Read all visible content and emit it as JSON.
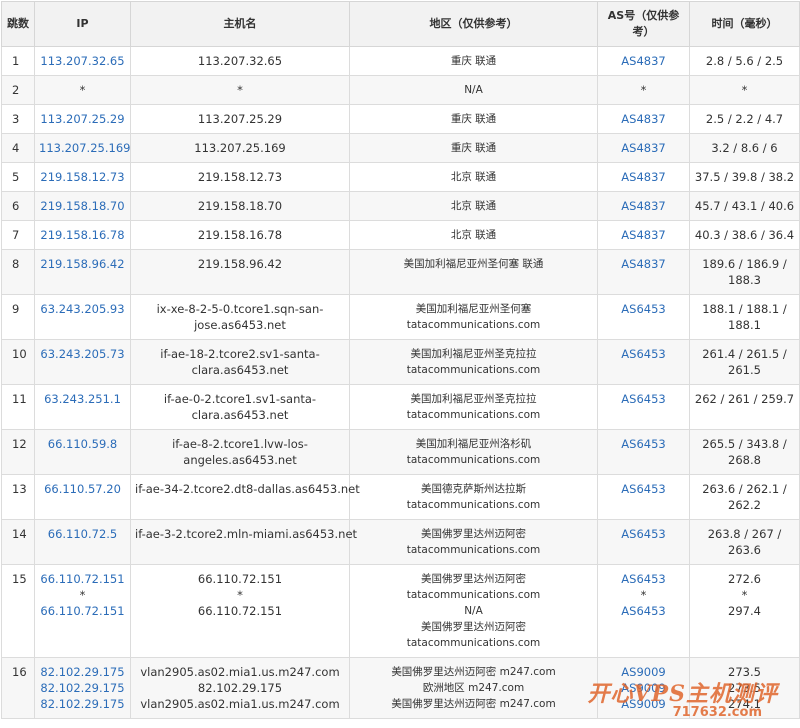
{
  "headers": {
    "hop": "跳数",
    "ip": "IP",
    "host": "主机名",
    "region": "地区（仅供参考）",
    "as": "AS号（仅供参考）",
    "time": "时间（毫秒）"
  },
  "rows": [
    {
      "hop": "1",
      "ips": [
        "113.207.32.65"
      ],
      "hosts": [
        "113.207.32.65"
      ],
      "regions": [
        "重庆 联通"
      ],
      "as": [
        "AS4837"
      ],
      "times": [
        "2.8 / 5.6 / 2.5"
      ]
    },
    {
      "hop": "2",
      "ips": [
        "*"
      ],
      "hosts": [
        "*"
      ],
      "regions": [
        "N/A"
      ],
      "as": [
        "*"
      ],
      "times": [
        "*"
      ]
    },
    {
      "hop": "3",
      "ips": [
        "113.207.25.29"
      ],
      "hosts": [
        "113.207.25.29"
      ],
      "regions": [
        "重庆 联通"
      ],
      "as": [
        "AS4837"
      ],
      "times": [
        "2.5 / 2.2 / 4.7"
      ]
    },
    {
      "hop": "4",
      "ips": [
        "113.207.25.169"
      ],
      "hosts": [
        "113.207.25.169"
      ],
      "regions": [
        "重庆 联通"
      ],
      "as": [
        "AS4837"
      ],
      "times": [
        "3.2 / 8.6 / 6"
      ]
    },
    {
      "hop": "5",
      "ips": [
        "219.158.12.73"
      ],
      "hosts": [
        "219.158.12.73"
      ],
      "regions": [
        "北京 联通"
      ],
      "as": [
        "AS4837"
      ],
      "times": [
        "37.5 / 39.8 / 38.2"
      ]
    },
    {
      "hop": "6",
      "ips": [
        "219.158.18.70"
      ],
      "hosts": [
        "219.158.18.70"
      ],
      "regions": [
        "北京 联通"
      ],
      "as": [
        "AS4837"
      ],
      "times": [
        "45.7 / 43.1 / 40.6"
      ]
    },
    {
      "hop": "7",
      "ips": [
        "219.158.16.78"
      ],
      "hosts": [
        "219.158.16.78"
      ],
      "regions": [
        "北京 联通"
      ],
      "as": [
        "AS4837"
      ],
      "times": [
        "40.3 / 38.6 / 36.4"
      ]
    },
    {
      "hop": "8",
      "ips": [
        "219.158.96.42"
      ],
      "hosts": [
        "219.158.96.42"
      ],
      "regions": [
        "美国加利福尼亚州圣何塞 联通"
      ],
      "as": [
        "AS4837"
      ],
      "times": [
        "189.6 / 186.9 /",
        "188.3"
      ]
    },
    {
      "hop": "9",
      "ips": [
        "63.243.205.93"
      ],
      "hosts": [
        "ix-xe-8-2-5-0.tcore1.sqn-san-",
        "jose.as6453.net"
      ],
      "regions": [
        "美国加利福尼亚州圣何塞",
        "tatacommunications.com"
      ],
      "as": [
        "AS6453"
      ],
      "times": [
        "188.1 / 188.1 /",
        "188.1"
      ]
    },
    {
      "hop": "10",
      "ips": [
        "63.243.205.73"
      ],
      "hosts": [
        "if-ae-18-2.tcore2.sv1-santa-",
        "clara.as6453.net"
      ],
      "regions": [
        "美国加利福尼亚州圣克拉拉",
        "tatacommunications.com"
      ],
      "as": [
        "AS6453"
      ],
      "times": [
        "261.4 / 261.5 /",
        "261.5"
      ]
    },
    {
      "hop": "11",
      "ips": [
        "63.243.251.1"
      ],
      "hosts": [
        "if-ae-0-2.tcore1.sv1-santa-",
        "clara.as6453.net"
      ],
      "regions": [
        "美国加利福尼亚州圣克拉拉",
        "tatacommunications.com"
      ],
      "as": [
        "AS6453"
      ],
      "times": [
        "262 / 261 / 259.7"
      ]
    },
    {
      "hop": "12",
      "ips": [
        "66.110.59.8"
      ],
      "hosts": [
        "if-ae-8-2.tcore1.lvw-los-",
        "angeles.as6453.net"
      ],
      "regions": [
        "美国加利福尼亚州洛杉矶",
        "tatacommunications.com"
      ],
      "as": [
        "AS6453"
      ],
      "times": [
        "265.5 / 343.8 /",
        "268.8"
      ]
    },
    {
      "hop": "13",
      "ips": [
        "66.110.57.20"
      ],
      "hosts": [
        "if-ae-34-2.tcore2.dt8-dallas.as6453.net"
      ],
      "regions": [
        "美国德克萨斯州达拉斯",
        "tatacommunications.com"
      ],
      "as": [
        "AS6453"
      ],
      "times": [
        "263.6 / 262.1 /",
        "262.2"
      ]
    },
    {
      "hop": "14",
      "ips": [
        "66.110.72.5"
      ],
      "hosts": [
        "if-ae-3-2.tcore2.mln-miami.as6453.net"
      ],
      "regions": [
        "美国佛罗里达州迈阿密",
        "tatacommunications.com"
      ],
      "as": [
        "AS6453"
      ],
      "times": [
        "263.8 / 267 /",
        "263.6"
      ]
    },
    {
      "hop": "15",
      "ips": [
        "66.110.72.151",
        "*",
        "66.110.72.151"
      ],
      "hosts": [
        "66.110.72.151",
        "*",
        "66.110.72.151"
      ],
      "regions": [
        "美国佛罗里达州迈阿密",
        "tatacommunications.com",
        "N/A",
        "美国佛罗里达州迈阿密",
        "tatacommunications.com"
      ],
      "as": [
        "AS6453",
        "*",
        "AS6453"
      ],
      "times": [
        "272.6",
        "*",
        "297.4"
      ]
    },
    {
      "hop": "16",
      "ips": [
        "82.102.29.175",
        "82.102.29.175",
        "82.102.29.175"
      ],
      "hosts": [
        "vlan2905.as02.mia1.us.m247.com",
        "82.102.29.175",
        "vlan2905.as02.mia1.us.m247.com"
      ],
      "regions": [
        "美国佛罗里达州迈阿密 m247.com",
        "欧洲地区 m247.com",
        "美国佛罗里达州迈阿密 m247.com"
      ],
      "as": [
        "AS9009",
        "AS9009",
        "AS9009"
      ],
      "times": [
        "273.5",
        "273.5",
        "274.1"
      ]
    }
  ],
  "watermark": {
    "title": "开心VPS主机测评",
    "url": "717632.com"
  }
}
